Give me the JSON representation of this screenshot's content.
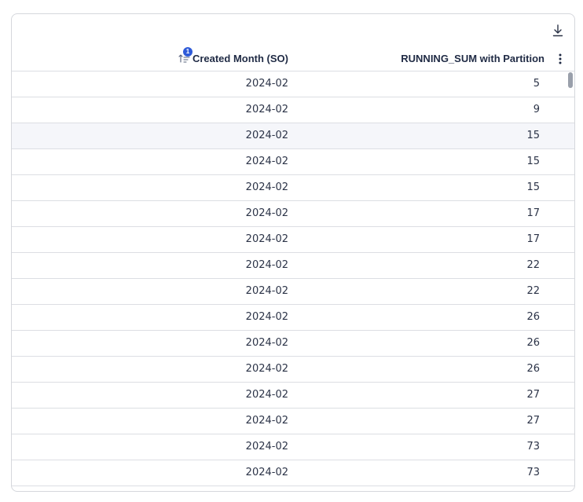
{
  "table": {
    "columns": [
      {
        "label": "Created Month (SO)",
        "sort_order": "1"
      },
      {
        "label": "RUNNING_SUM with Partition"
      }
    ],
    "rows": [
      {
        "month": "2024-02",
        "value": "5"
      },
      {
        "month": "2024-02",
        "value": "9"
      },
      {
        "month": "2024-02",
        "value": "15"
      },
      {
        "month": "2024-02",
        "value": "15"
      },
      {
        "month": "2024-02",
        "value": "15"
      },
      {
        "month": "2024-02",
        "value": "17"
      },
      {
        "month": "2024-02",
        "value": "17"
      },
      {
        "month": "2024-02",
        "value": "22"
      },
      {
        "month": "2024-02",
        "value": "22"
      },
      {
        "month": "2024-02",
        "value": "26"
      },
      {
        "month": "2024-02",
        "value": "26"
      },
      {
        "month": "2024-02",
        "value": "26"
      },
      {
        "month": "2024-02",
        "value": "27"
      },
      {
        "month": "2024-02",
        "value": "27"
      },
      {
        "month": "2024-02",
        "value": "73"
      },
      {
        "month": "2024-02",
        "value": "73"
      }
    ],
    "hovered_row": 2
  },
  "icons": {
    "download": "download-icon",
    "sort": "sort-ascending-icon",
    "menu": "more-vertical-icon"
  },
  "colors": {
    "accent": "#2f5bd8",
    "header_text": "#1f2a44",
    "cell_text": "#2b3347",
    "border": "#dcdee3",
    "hover_row": "#f5f6fa"
  }
}
